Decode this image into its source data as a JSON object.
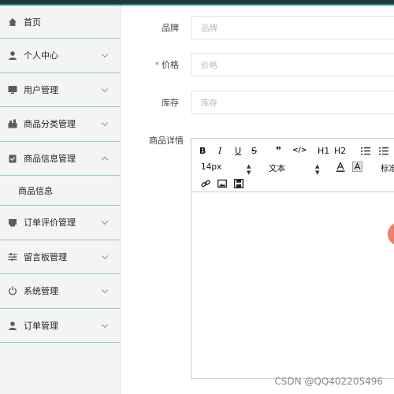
{
  "sidebar": {
    "items": [
      {
        "label": "首页",
        "icon": "home-icon",
        "chevron": "none"
      },
      {
        "label": "个人中心",
        "icon": "user-icon",
        "chevron": "down"
      },
      {
        "label": "用户管理",
        "icon": "monitor-icon",
        "chevron": "down"
      },
      {
        "label": "商品分类管理",
        "icon": "category-icon",
        "chevron": "down"
      },
      {
        "label": "商品信息管理",
        "icon": "clipboard-icon",
        "chevron": "up"
      },
      {
        "label": "订单评价管理",
        "icon": "printer-icon",
        "chevron": "down"
      },
      {
        "label": "留言板管理",
        "icon": "sliders-icon",
        "chevron": "down"
      },
      {
        "label": "系统管理",
        "icon": "power-icon",
        "chevron": "down"
      },
      {
        "label": "订单管理",
        "icon": "user-icon",
        "chevron": "down"
      }
    ],
    "sub_item": "商品信息"
  },
  "form": {
    "brand": {
      "label": "品牌",
      "placeholder": "品牌"
    },
    "price": {
      "required_mark": "*",
      "label": "价格",
      "placeholder": "价格"
    },
    "stock": {
      "label": "库存",
      "placeholder": "库存"
    },
    "detail": {
      "label": "商品详情"
    }
  },
  "editor": {
    "bold": "B",
    "italic": "I",
    "underline": "U",
    "strike": "S",
    "quote": "❞",
    "code": "</>",
    "h1": "H1",
    "h2": "H2",
    "font_size": "14px",
    "font_family": "文本",
    "header_more": "标准"
  },
  "watermark": "CSDN @QQ402205496",
  "colors": {
    "topbar": "#1f3a3a",
    "accent": "#2a8a86",
    "divider": "#8fcfb9",
    "float_button": "#e9826a"
  }
}
